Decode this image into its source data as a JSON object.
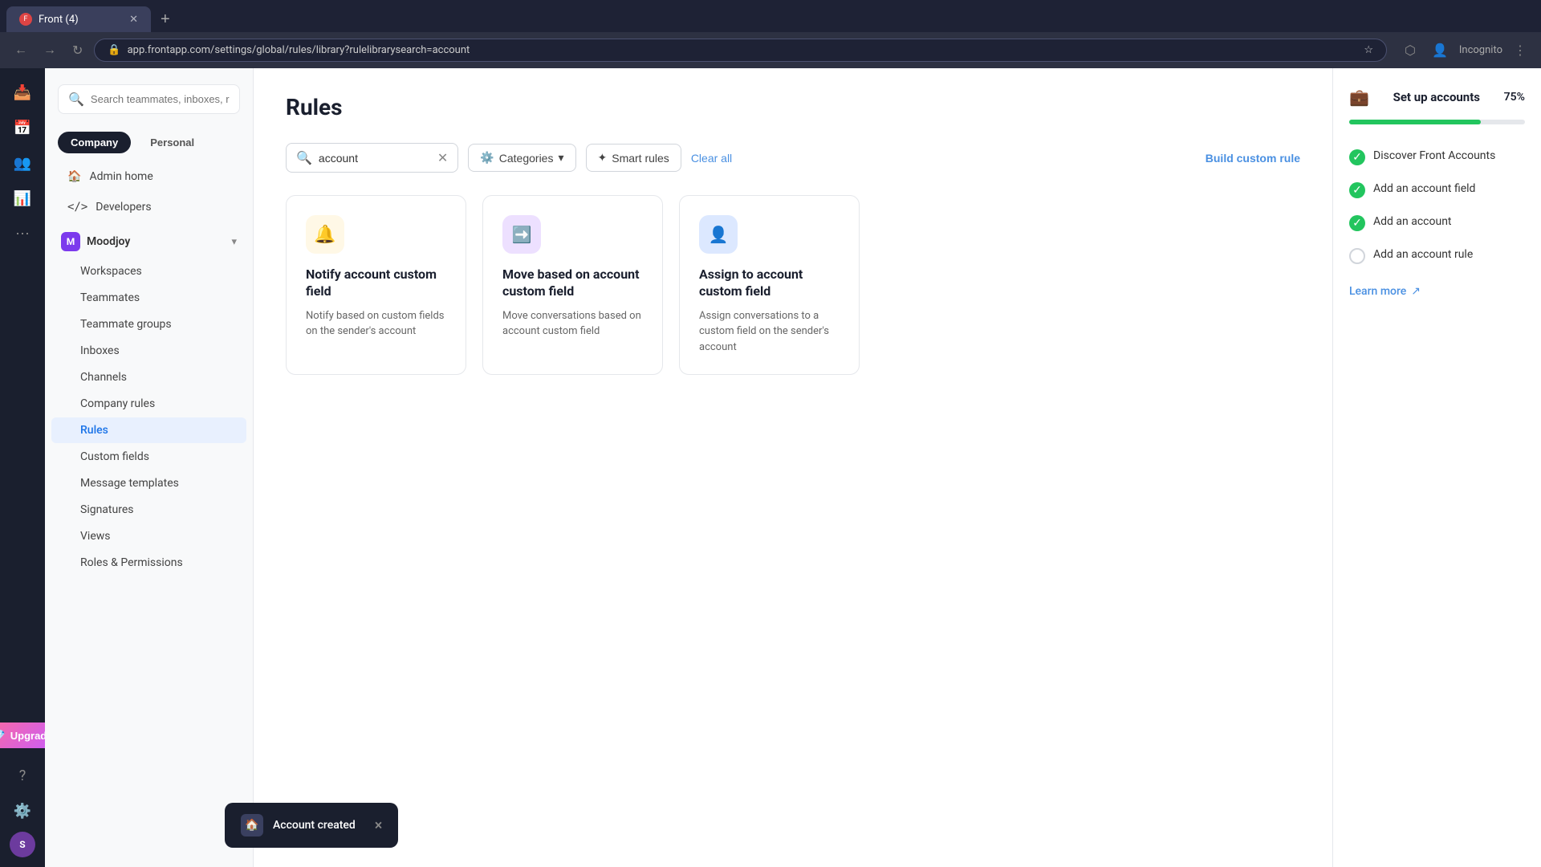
{
  "browser": {
    "tab_title": "Front (4)",
    "url": "app.frontapp.com/settings/global/rules/library?rulelibrarysearch=account",
    "tab_new_label": "+",
    "incognito_label": "Incognito"
  },
  "topbar": {
    "search_placeholder": "Search teammates, inboxes, rules, tags, and more",
    "upgrade_label": "Upgrade"
  },
  "sidebar": {
    "company_label": "Company",
    "personal_label": "Personal",
    "admin_home_label": "Admin home",
    "developers_label": "Developers",
    "company_name": "Moodjoy",
    "workspaces_label": "Workspaces",
    "teammates_label": "Teammates",
    "teammate_groups_label": "Teammate groups",
    "inboxes_label": "Inboxes",
    "channels_label": "Channels",
    "company_rules_label": "Company rules",
    "rules_label": "Rules",
    "custom_fields_label": "Custom fields",
    "message_templates_label": "Message templates",
    "signatures_label": "Signatures",
    "views_label": "Views",
    "roles_permissions_label": "Roles & Permissions"
  },
  "main": {
    "page_title": "Rules",
    "search_value": "account",
    "categories_label": "Categories",
    "smart_rules_label": "Smart rules",
    "clear_all_label": "Clear all",
    "build_custom_rule_label": "Build custom rule",
    "cards": [
      {
        "title": "Notify account custom field",
        "desc": "Notify based on custom fields on the sender's account",
        "icon_color": "#fff8e6",
        "icon": "🔔",
        "icon_bg": "#fff8e6"
      },
      {
        "title": "Move based on account custom field",
        "desc": "Move conversations based on account custom field",
        "icon_color": "#f0e8ff",
        "icon": "➡️",
        "icon_bg": "#ede0ff"
      },
      {
        "title": "Assign to account custom field",
        "desc": "Assign conversations to a custom field on the sender's account",
        "icon_color": "#e8f0ff",
        "icon": "👤",
        "icon_bg": "#dce8ff"
      }
    ]
  },
  "right_panel": {
    "title": "Set up accounts",
    "progress_pct": "75%",
    "progress_value": 75,
    "items": [
      {
        "label": "Discover Front Accounts",
        "done": true
      },
      {
        "label": "Add an account field",
        "done": true
      },
      {
        "label": "Add an account",
        "done": true
      },
      {
        "label": "Add an account rule",
        "done": false
      }
    ],
    "learn_more_label": "Learn more"
  },
  "toast": {
    "label": "Account created",
    "close_label": "×"
  }
}
